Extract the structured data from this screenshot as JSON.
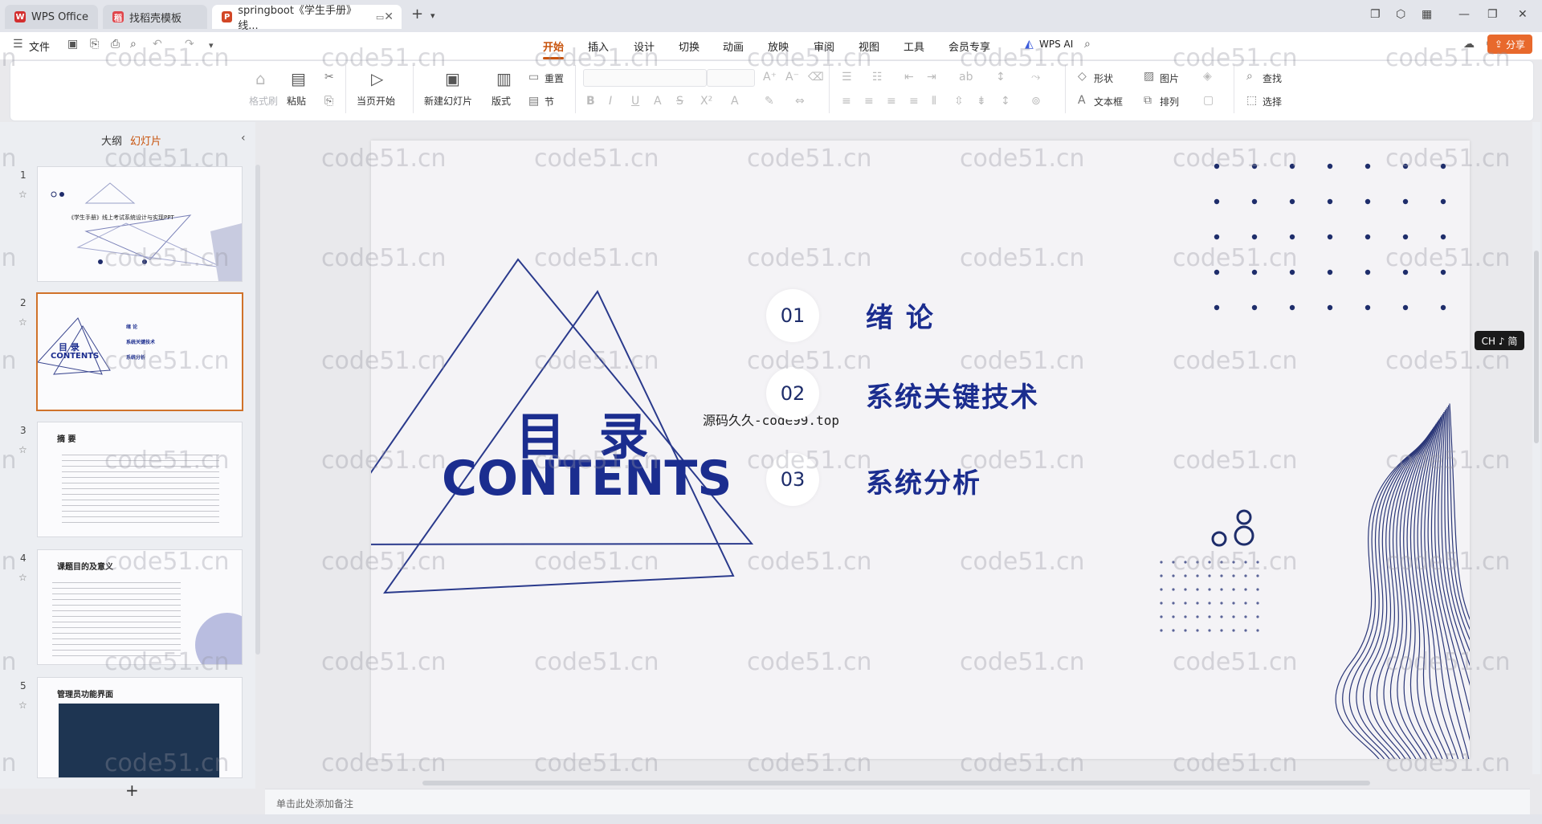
{
  "tabs": [
    {
      "label": "WPS Office",
      "icon": "wps-logo-icon"
    },
    {
      "label": "找稻壳模板",
      "icon": "docer-icon"
    },
    {
      "label": "springboot《学生手册》线...",
      "icon": "ppt-file-icon"
    }
  ],
  "menu": {
    "file_label": "文件",
    "tabs": [
      "开始",
      "插入",
      "设计",
      "切换",
      "动画",
      "放映",
      "审阅",
      "视图",
      "工具",
      "会员专享"
    ],
    "ai_label": "WPS AI",
    "share_label": "分享"
  },
  "ribbon": {
    "format_painter": "格式刷",
    "paste": "粘贴",
    "play_from_current": "当页开始",
    "new_slide": "新建幻灯片",
    "layout": "版式",
    "section": "节",
    "reset": "重置",
    "shape": "形状",
    "picture": "图片",
    "textbox": "文本框",
    "arrange": "排列",
    "find": "查找",
    "select": "选择"
  },
  "panel": {
    "outline_tab": "大纲",
    "slides_tab": "幻灯片",
    "add_button": "+"
  },
  "thumbnails": [
    {
      "num": "1",
      "title": "《学生手册》线上考试系统设计与实现PPT"
    },
    {
      "num": "2",
      "title": "目录 CONTENTS",
      "items": [
        "绪 论",
        "系统关键技术",
        "系统分析"
      ]
    },
    {
      "num": "3",
      "title": "摘 要"
    },
    {
      "num": "4",
      "title": "课题目的及意义"
    },
    {
      "num": "5",
      "title": "管理员功能界面"
    }
  ],
  "slide": {
    "heading_cn": "目 录",
    "heading_en": "CONTENTS",
    "overlay_text": "源码久久-code99.top",
    "items": [
      {
        "num": "01",
        "title": "绪 论"
      },
      {
        "num": "02",
        "title": "系统关键技术"
      },
      {
        "num": "03",
        "title": "系统分析"
      }
    ]
  },
  "ime_badge": "CH ♪ 简",
  "notes_placeholder": "单击此处添加备注",
  "watermark_text": "code51.cn",
  "colors": {
    "accent_orange": "#c8530c",
    "slide_blue": "#1b2d8f",
    "line_blue": "#2a3a8c"
  }
}
